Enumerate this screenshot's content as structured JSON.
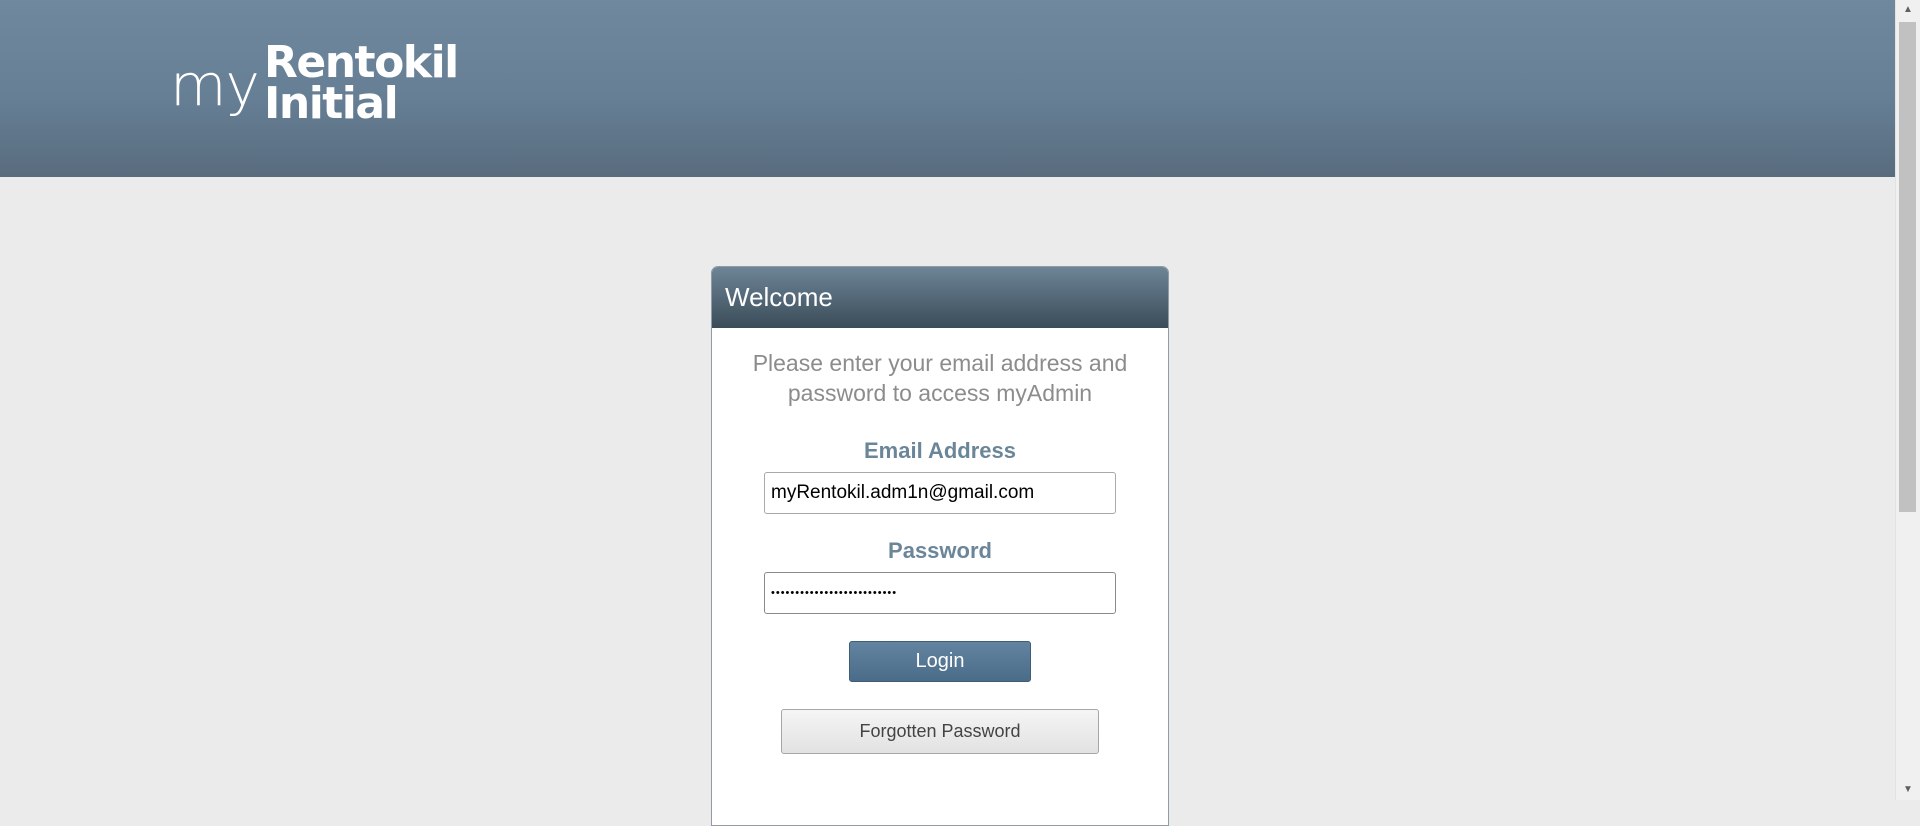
{
  "header": {
    "logo_prefix": "my",
    "logo_line1": "Rentokil",
    "logo_line2": "Initial"
  },
  "login": {
    "title": "Welcome",
    "intro": "Please enter your email address and password to access myAdmin",
    "email_label": "Email Address",
    "email_value": "myRentokil.adm1n@gmail.com",
    "password_label": "Password",
    "password_value": "••••••••••••••••••••••••••",
    "login_button": "Login",
    "forgot_button": "Forgotten Password"
  },
  "scrollbar": {
    "up_glyph": "▲",
    "down_glyph": "▼"
  }
}
